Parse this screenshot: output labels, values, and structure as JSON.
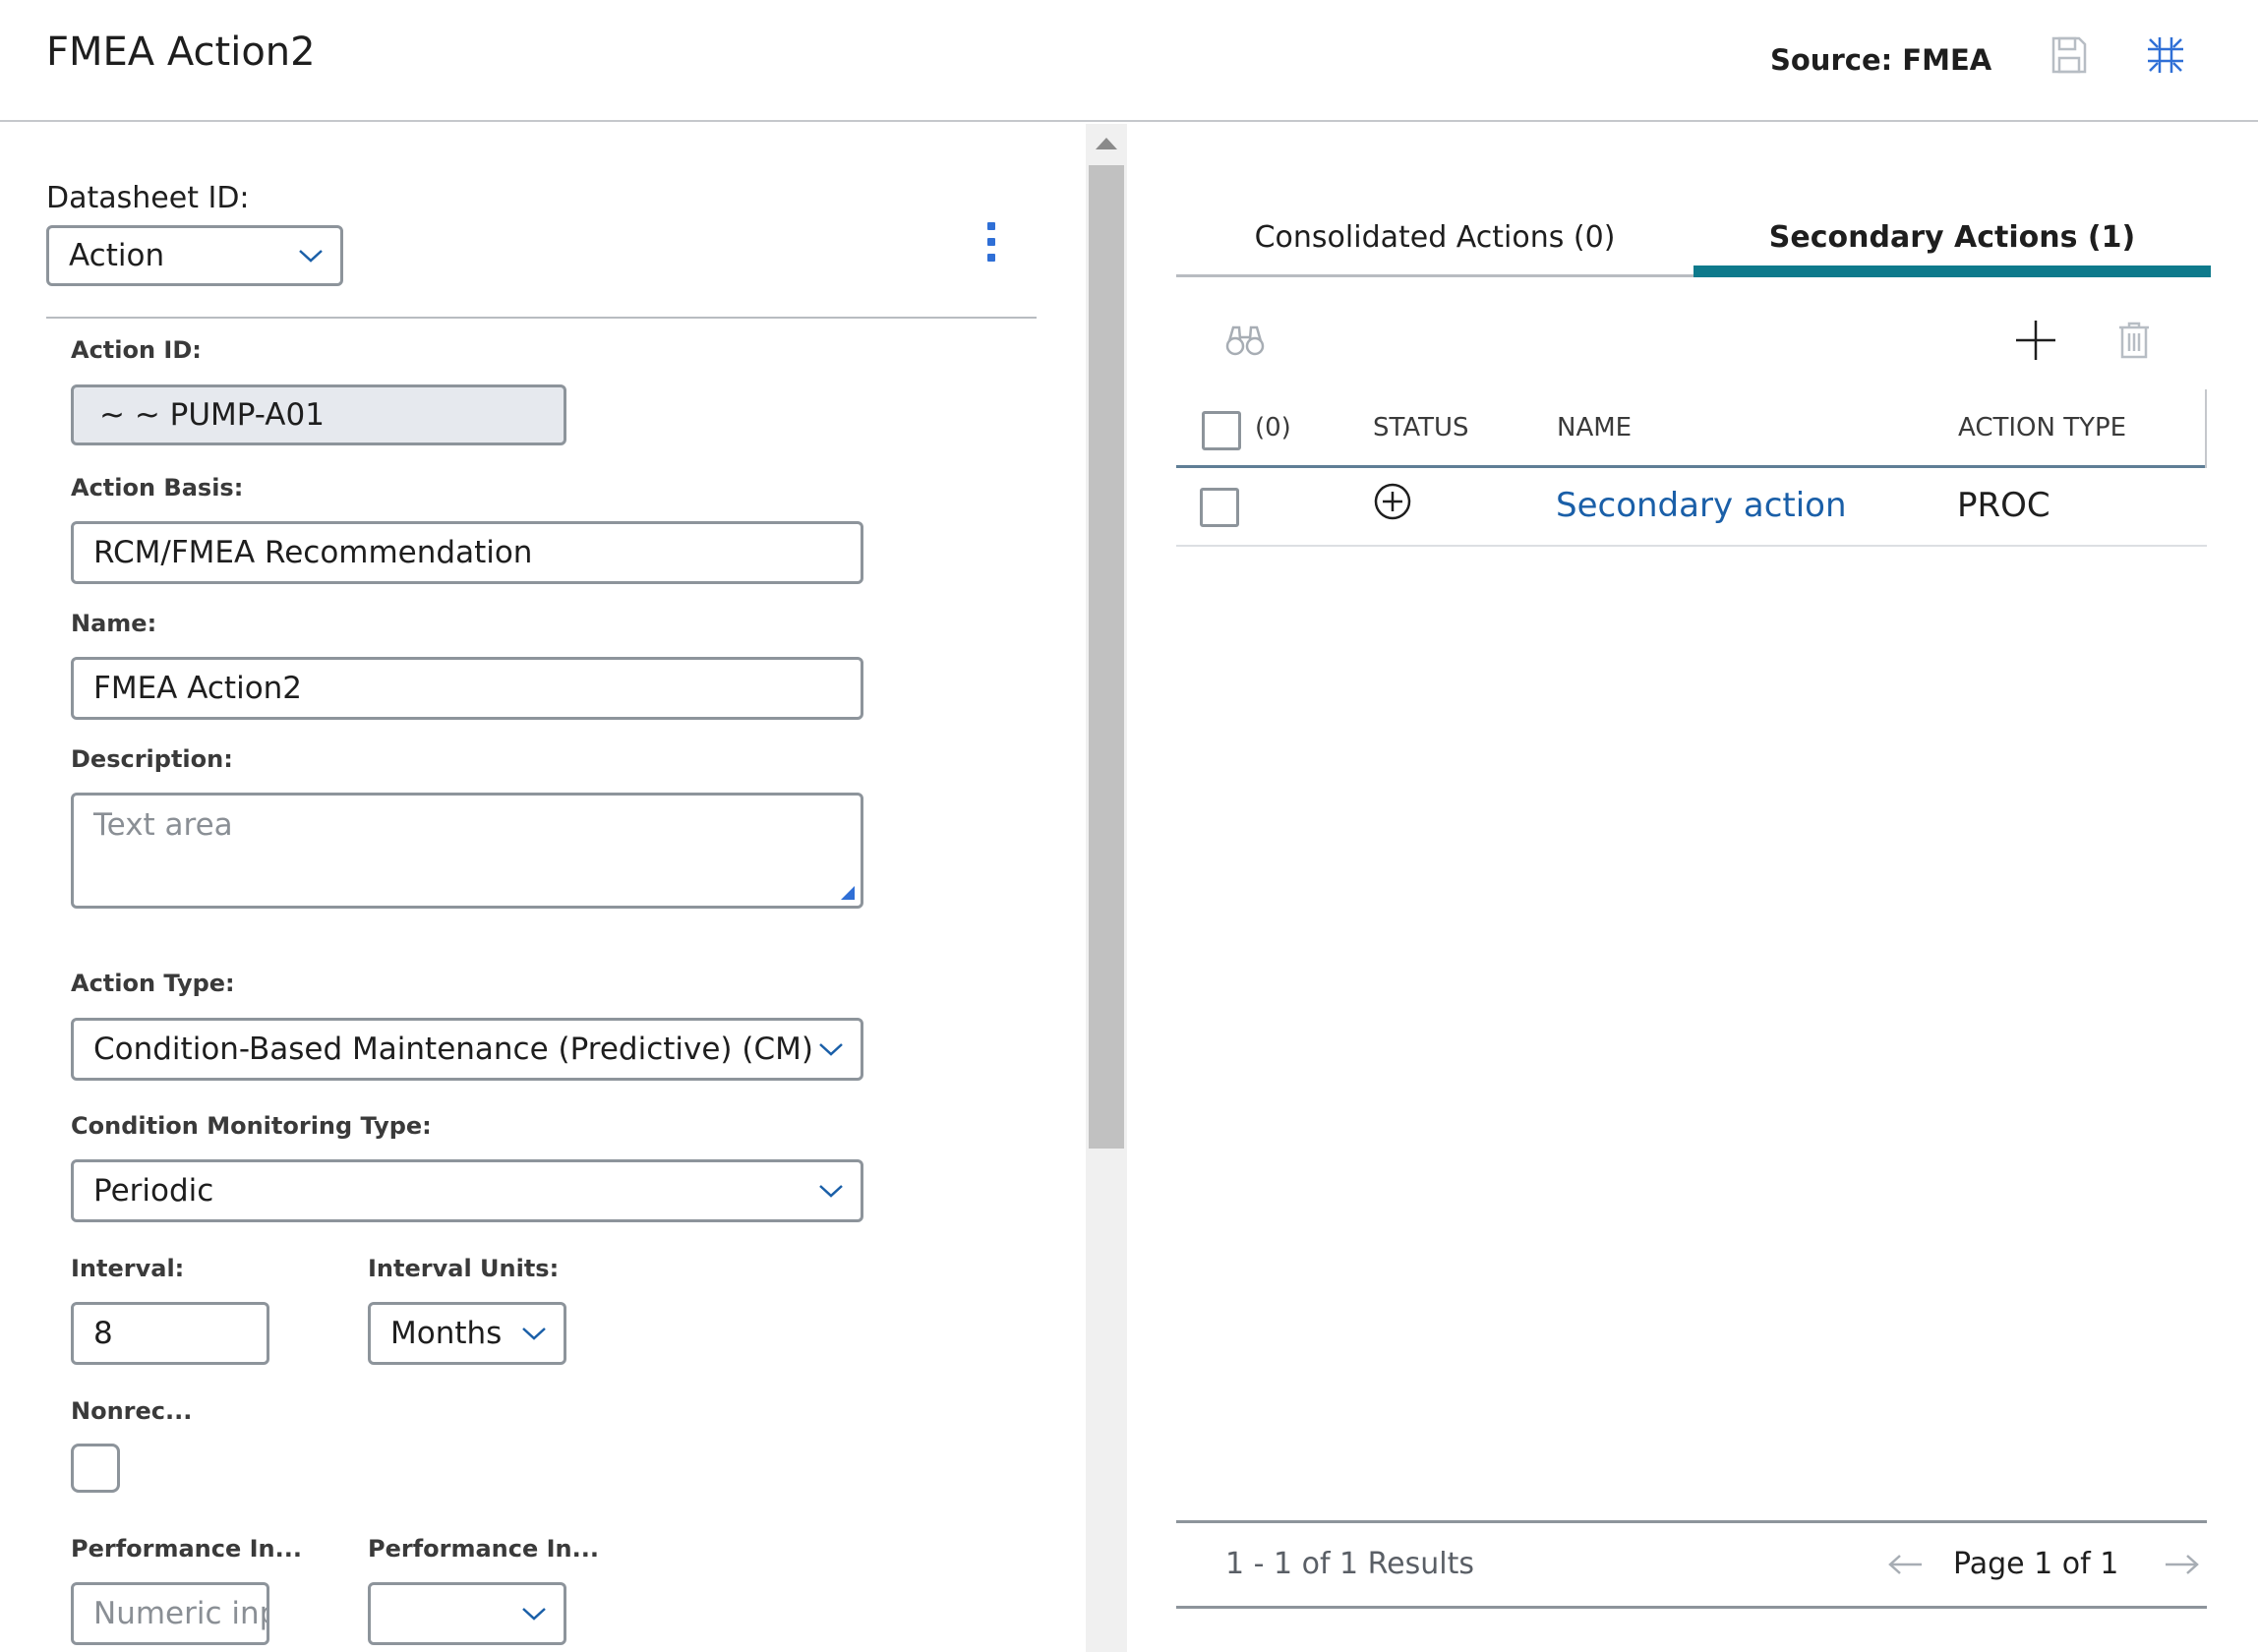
{
  "header": {
    "title": "FMEA Action2",
    "source_label": "Source: FMEA",
    "save_icon": "save-icon",
    "collapse_icon": "collapse-icon"
  },
  "form": {
    "datasheet_label": "Datasheet ID:",
    "datasheet_value": "Action",
    "action_id_label": "Action ID:",
    "action_id_value": "~ ~ PUMP-A01",
    "action_basis_label": "Action Basis:",
    "action_basis_value": "RCM/FMEA Recommendation",
    "name_label": "Name:",
    "name_value": "FMEA Action2",
    "description_label": "Description:",
    "description_placeholder": "Text area",
    "action_type_label": "Action Type:",
    "action_type_value": "Condition-Based Maintenance (Predictive) (CM)",
    "cm_type_label": "Condition Monitoring Type:",
    "cm_type_value": "Periodic",
    "interval_label": "Interval:",
    "interval_value": "8",
    "interval_units_label": "Interval Units:",
    "interval_units_value": "Months",
    "nonrec_label": "Nonrec...",
    "perf_in_label_1": "Performance In...",
    "perf_in_placeholder": "Numeric inp",
    "perf_in_label_2": "Performance In...",
    "perf_in_value_2": ""
  },
  "tabs": {
    "consolidated": "Consolidated Actions (0)",
    "secondary": "Secondary Actions (1)"
  },
  "grid": {
    "selected_count": "(0)",
    "columns": [
      "STATUS",
      "NAME",
      "ACTION TYPE"
    ],
    "rows": [
      {
        "status_icon": "plus-circle-icon",
        "name": "Secondary action",
        "action_type": "PROC"
      }
    ]
  },
  "footer": {
    "results": "1 - 1 of 1 Results",
    "page": "Page 1 of 1"
  },
  "colors": {
    "accent_teal": "#0e7a8c",
    "link_blue": "#1a5fa8",
    "icon_blue": "#2f6fd6"
  }
}
